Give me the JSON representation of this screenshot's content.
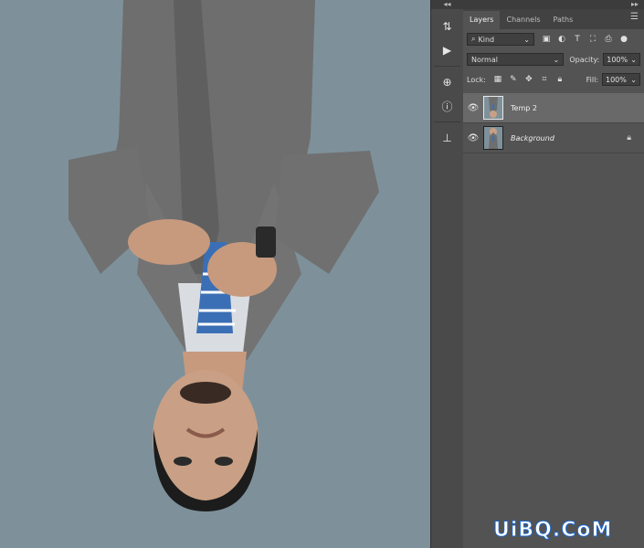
{
  "toolstrip": {
    "collapse_glyph": "◂◂",
    "tools": [
      {
        "name": "history-brush-icon",
        "glyph": "⇅"
      },
      {
        "name": "play-action-icon",
        "glyph": "▶"
      },
      {
        "name": "layer-comps-icon",
        "glyph": "⊕"
      },
      {
        "name": "info-icon",
        "glyph": "ⓘ"
      },
      {
        "name": "clone-source-icon",
        "glyph": "⊥"
      }
    ]
  },
  "panel": {
    "collapse_glyph": "▸▸",
    "tabs": [
      {
        "label": "Layers",
        "active": true
      },
      {
        "label": "Channels",
        "active": false
      },
      {
        "label": "Paths",
        "active": false
      }
    ],
    "filter": {
      "kind_label": "Kind",
      "icons": [
        "image-filter-icon",
        "adjustment-filter-icon",
        "type-filter-icon",
        "shape-filter-icon",
        "smart-object-filter-icon",
        "filter-toggle-icon"
      ]
    },
    "blend_mode": "Normal",
    "opacity_label": "Opacity:",
    "opacity_value": "100%",
    "lock_label": "Lock:",
    "fill_label": "Fill:",
    "fill_value": "100%",
    "layers": [
      {
        "name": "Temp 2",
        "selected": true,
        "italic": false,
        "locked": false
      },
      {
        "name": "Background",
        "selected": false,
        "italic": true,
        "locked": true
      }
    ]
  },
  "watermark": "UiBQ.CoM",
  "colors": {
    "canvas_bg": "#7e919b",
    "panel_bg": "#535353",
    "selected_layer": "#696969",
    "watermark_stroke": "#1d67c9"
  }
}
